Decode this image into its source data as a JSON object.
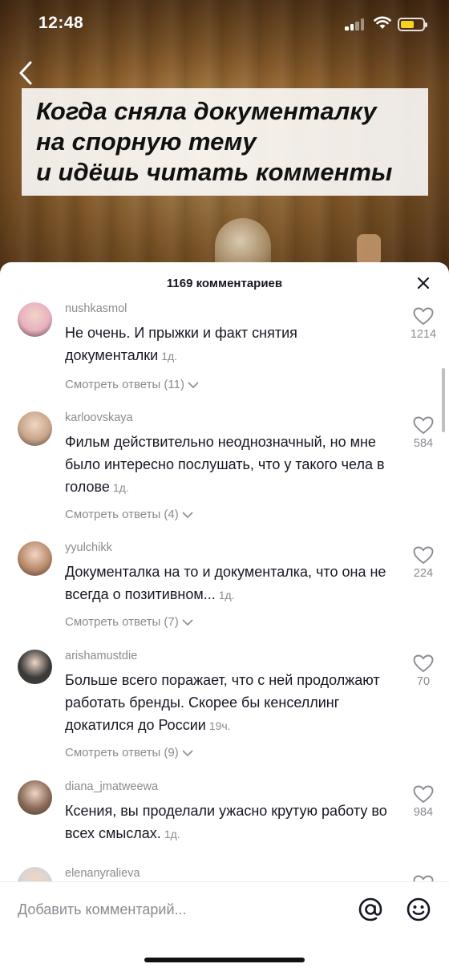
{
  "status_bar": {
    "time": "12:48",
    "battery_level": 0.6,
    "battery_color": "#f6d31e"
  },
  "video": {
    "caption_lines": [
      "Когда сняла документалку",
      "на спорную тему",
      "и идёшь читать комменты"
    ]
  },
  "sheet": {
    "title": "1169 комментариев",
    "comments": [
      {
        "username": "nushkasmol",
        "text": "Не очень. И прыжки и факт снятия документалки",
        "time": "1д.",
        "likes": "1214",
        "replies": "Смотреть ответы (11)",
        "avatar_color": "#e8b0c0"
      },
      {
        "username": "karloovskaya",
        "text": "Фильм действительно неоднозначный, но мне было интересно послушать, что у такого чела в голове",
        "time": "1д.",
        "likes": "584",
        "replies": "Смотреть ответы (4)",
        "avatar_color": "#c9a58a"
      },
      {
        "username": "yyulchikk",
        "text": "Документалка на то и документалка, что она не всегда о позитивном...",
        "time": "1д.",
        "likes": "224",
        "replies": "Смотреть ответы (7)",
        "avatar_color": "#b98a6a"
      },
      {
        "username": "arishamustdie",
        "text": "Больше всего поражает, что с ней продолжают работать бренды. Скорее бы кенселлинг докатился до России",
        "time": "19ч.",
        "likes": "70",
        "replies": "Смотреть ответы (9)",
        "avatar_color": "#3a3a3a"
      },
      {
        "username": "diana_jmatweewa",
        "text": "Ксения, вы проделали ужасно крутую работу во всех смыслах.",
        "time": "1д.",
        "likes": "984",
        "replies": "",
        "avatar_color": "#8a6a58"
      },
      {
        "username": "elenanyralieva",
        "text": "",
        "time": "",
        "likes": "",
        "replies": "",
        "avatar_color": "#d5d5d5"
      }
    ]
  },
  "input": {
    "placeholder": "Добавить комментарий..."
  }
}
